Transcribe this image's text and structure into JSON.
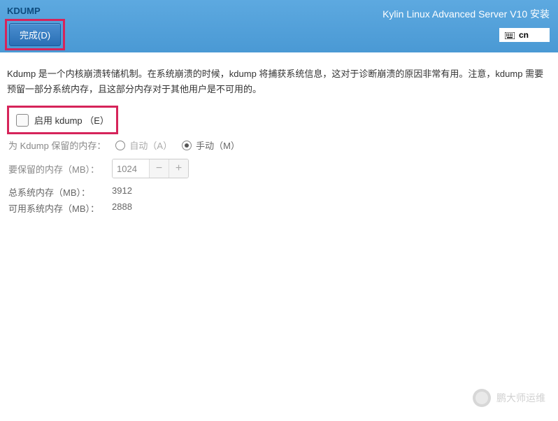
{
  "header": {
    "page_title": "KDUMP",
    "done_button": "完成(D)",
    "installer_title": "Kylin Linux Advanced Server V10 安装",
    "lang_code": "cn"
  },
  "content": {
    "description": "Kdump 是一个内核崩溃转储机制。在系统崩溃的时候，kdump 将捕获系统信息，这对于诊断崩溃的原因非常有用。注意，kdump 需要预留一部分系统内存，且这部分内存对于其他用户是不可用的。",
    "enable_label": "启用 kdump （E）",
    "reserved_label": "为 Kdump 保留的内存：",
    "radio_auto": "自动（A）",
    "radio_manual": "手动（M）",
    "reserve_mem_label": "要保留的内存（MB）：",
    "reserve_mem_value": "1024",
    "total_mem_label": "总系统内存（MB）：",
    "total_mem_value": "3912",
    "usable_mem_label": "可用系统内存（MB）：",
    "usable_mem_value": "2888"
  },
  "watermark": {
    "text": "鹏大师运维"
  }
}
